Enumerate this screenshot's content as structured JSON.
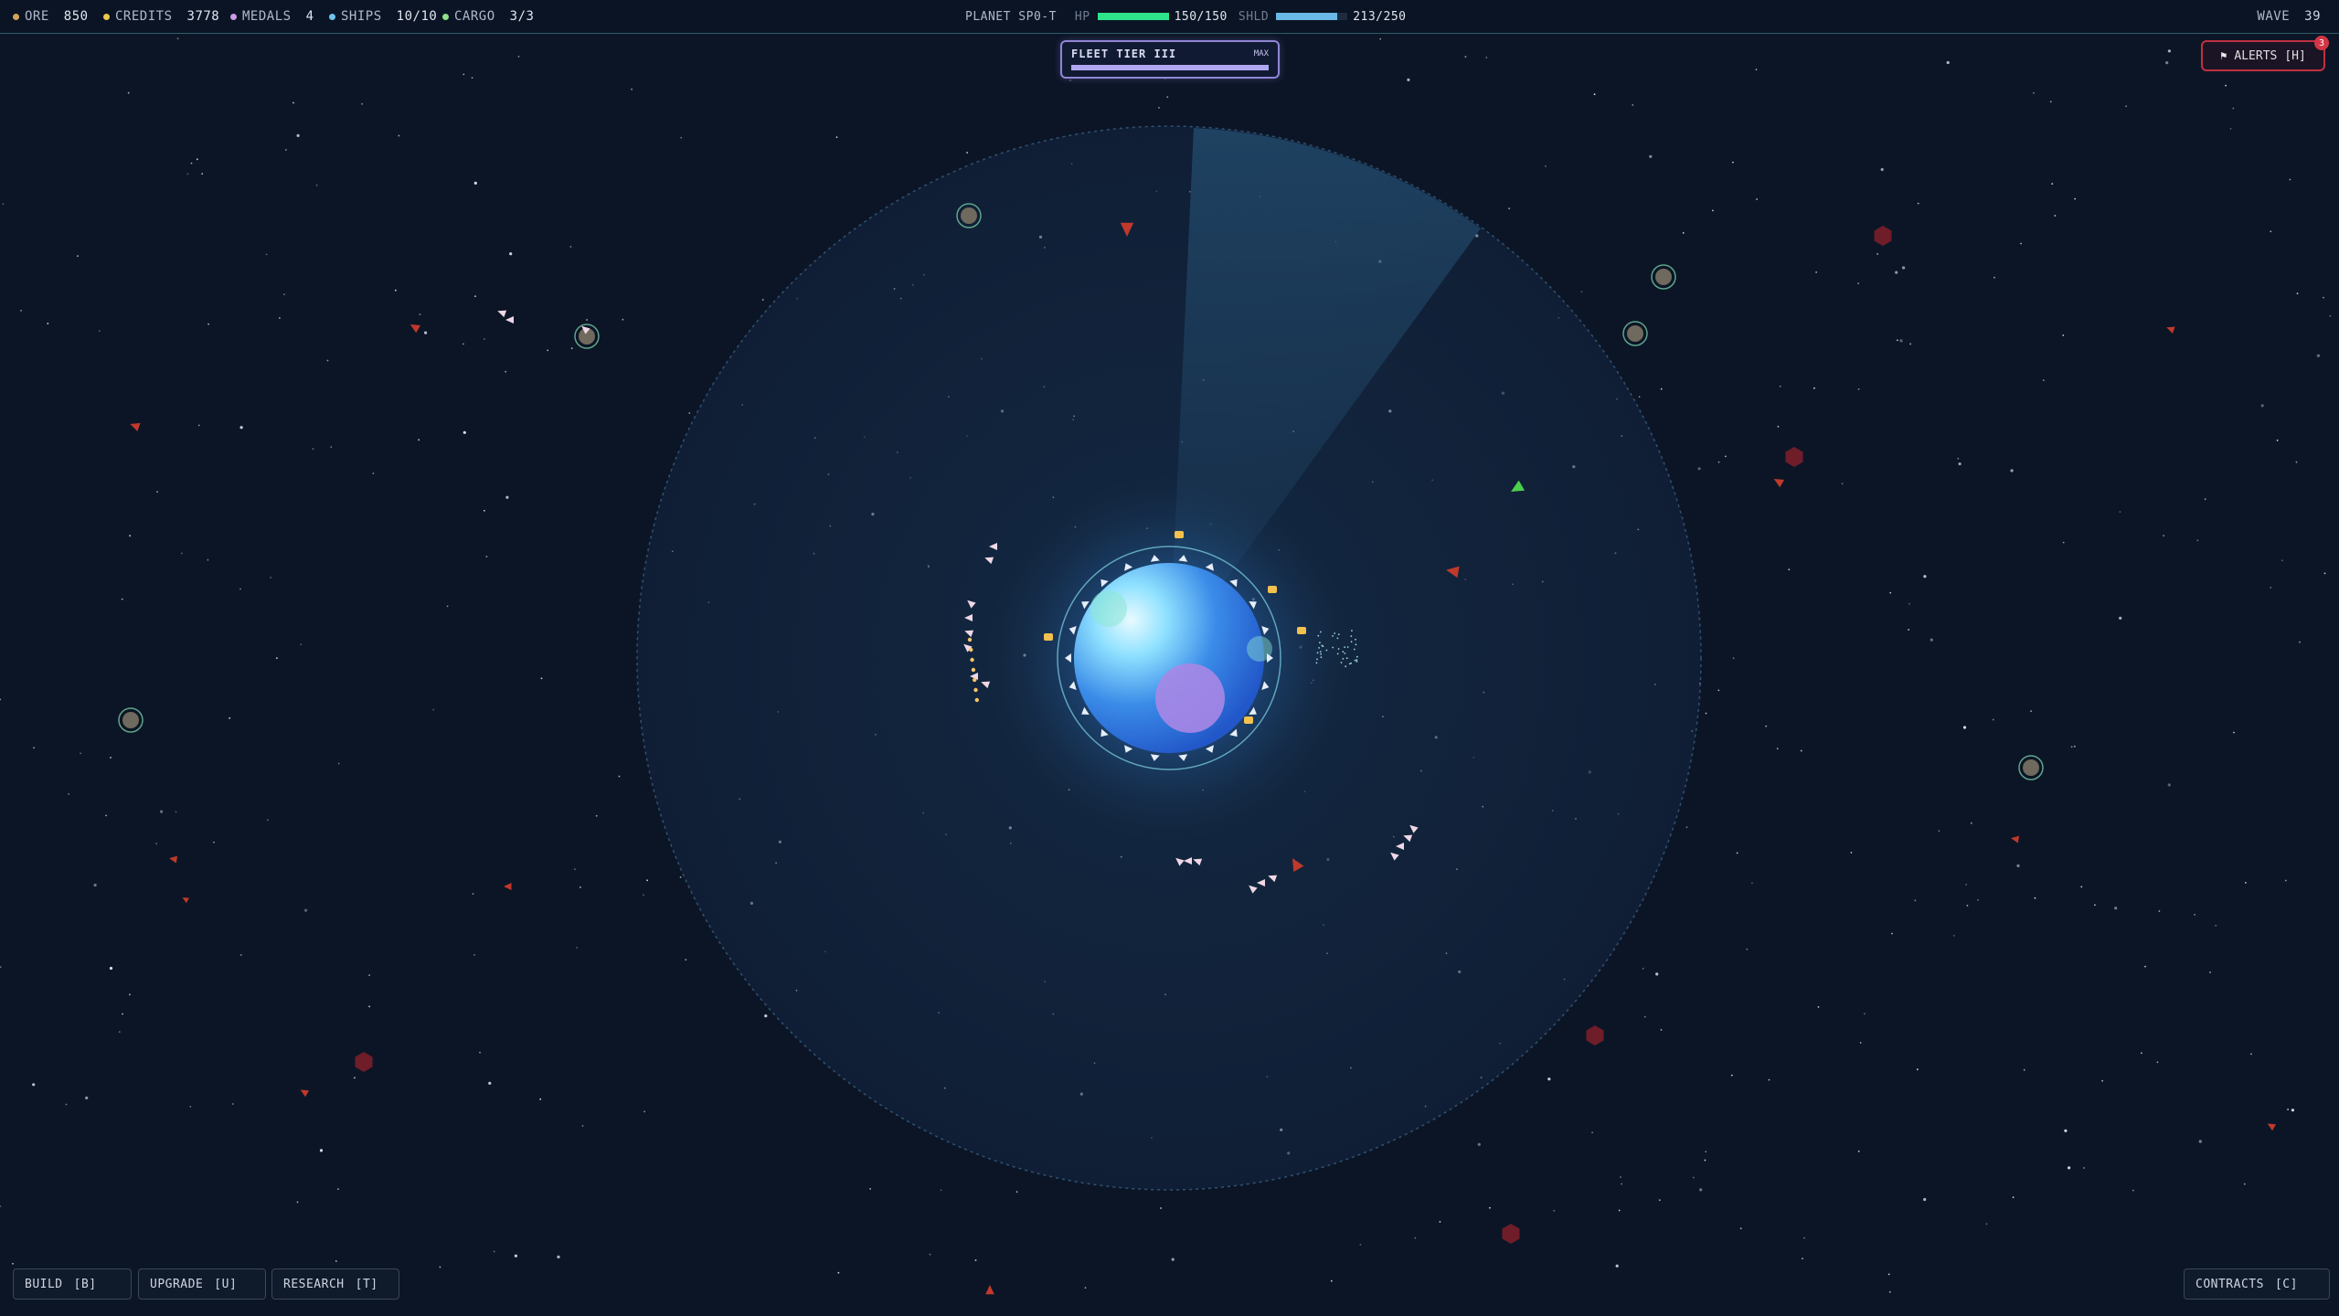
{
  "resources": [
    {
      "label": "ORE",
      "value": "850",
      "color": "#d2a45a"
    },
    {
      "label": "CREDITS",
      "value": "3778",
      "color": "#f0c94a"
    },
    {
      "label": "MEDALS",
      "value": "4",
      "color": "#c99ce8"
    },
    {
      "label": "SHIPS",
      "value": "10/10",
      "color": "#6fc3f0"
    },
    {
      "label": "CARGO",
      "value": "3/3",
      "color": "#8fe08a"
    }
  ],
  "planet": {
    "name": "PLANET SP0-T",
    "hp_label": "HP",
    "hp_value": "150/150",
    "hp_fraction": 1.0,
    "hp_color": "#2ee38a",
    "shield_label": "SHLD",
    "shield_value": "213/250",
    "shield_fraction": 0.852,
    "shield_color": "#6ab8e6"
  },
  "wave": {
    "label": "WAVE",
    "value": "39"
  },
  "fleet_tier": {
    "title": "FLEET TIER III",
    "status": "MAX",
    "progress": 1.0
  },
  "alerts": {
    "label": "ALERTS",
    "key": "[H]",
    "count": "3",
    "icon": "flag-icon"
  },
  "actions": [
    {
      "label": "BUILD",
      "key": "[B]"
    },
    {
      "label": "UPGRADE",
      "key": "[U]"
    },
    {
      "label": "RESEARCH",
      "key": "[T]"
    }
  ],
  "contracts": {
    "label": "CONTRACTS",
    "key": "[C]"
  },
  "colors": {
    "background": "#0c1526",
    "planet_core": "#dff6ff",
    "planet_mid": "#3a8be8",
    "moon": "#a987e6",
    "shield_zone": "#14304d",
    "enemy": "#c0392b",
    "hex_hazard": "#7a1e2a",
    "asteroid": "#6f6a5d",
    "friendly": "#e6eef9"
  }
}
